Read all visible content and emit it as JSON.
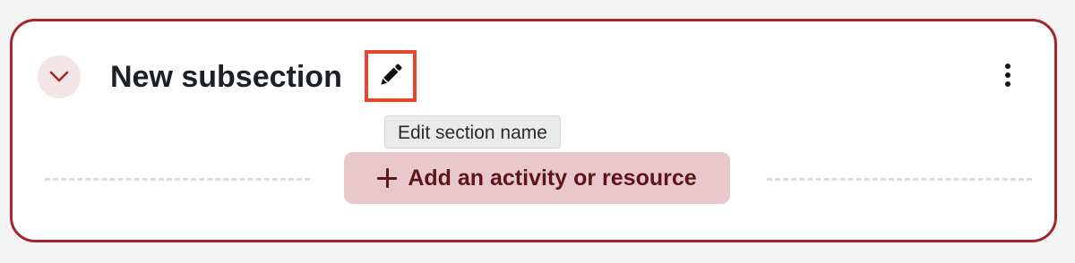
{
  "subsection": {
    "title": "New subsection",
    "collapse_icon": "chevron-down-icon",
    "edit_icon": "pencil-icon",
    "menu_icon": "vertical-ellipsis-icon",
    "edit_tooltip": "Edit section name",
    "add_button_label": "Add an activity or resource",
    "add_icon": "plus-icon"
  },
  "colors": {
    "accent": "#a3262f",
    "highlight_box": "#e8452a",
    "add_button_bg": "#e9c8cc",
    "add_button_text": "#5e1419",
    "collapse_button_bg": "#f3e4e6"
  }
}
